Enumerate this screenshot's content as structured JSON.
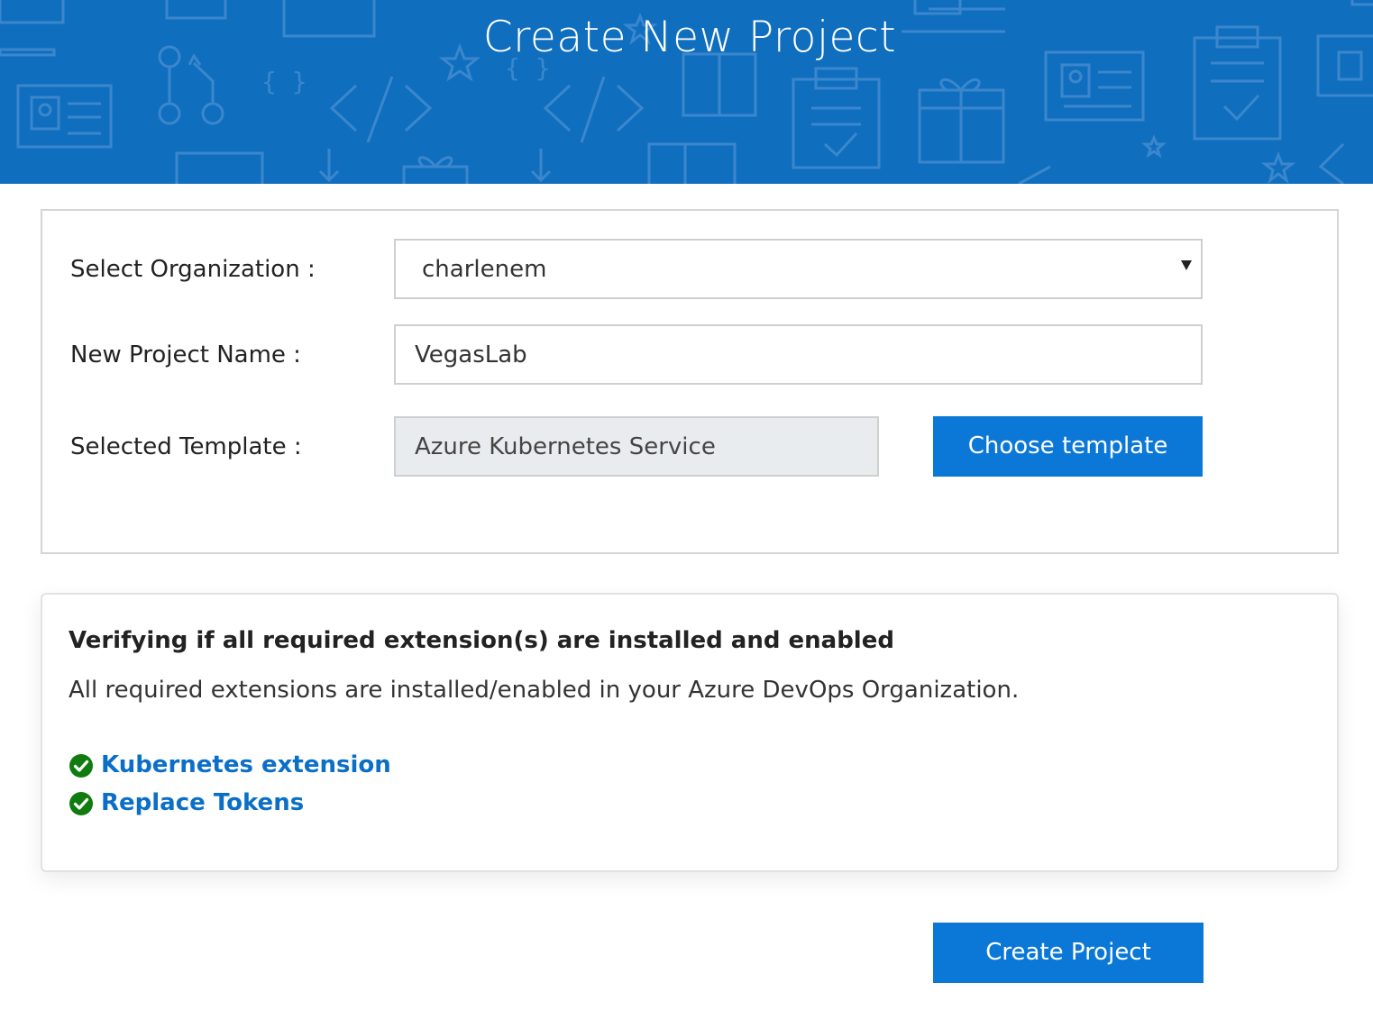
{
  "header": {
    "title": "Create New Project"
  },
  "form": {
    "organization": {
      "label": "Select Organization :",
      "value": "charlenem"
    },
    "project_name": {
      "label": "New Project Name :",
      "value": "VegasLab"
    },
    "template": {
      "label": "Selected Template :",
      "value": "Azure Kubernetes Service",
      "button_label": "Choose template"
    }
  },
  "extensions": {
    "title": "Verifying if all required extension(s) are installed and enabled",
    "description": "All required extensions are installed/enabled in your Azure DevOps Organization.",
    "items": [
      {
        "label": "Kubernetes extension",
        "status": "installed",
        "icon": "check-circle-icon"
      },
      {
        "label": "Replace Tokens",
        "status": "installed",
        "icon": "check-circle-icon"
      }
    ]
  },
  "actions": {
    "create_label": "Create Project"
  },
  "colors": {
    "banner": "#106ebe",
    "primary_button": "#0b78d7",
    "link": "#0b6fc7",
    "success": "#107c10"
  }
}
